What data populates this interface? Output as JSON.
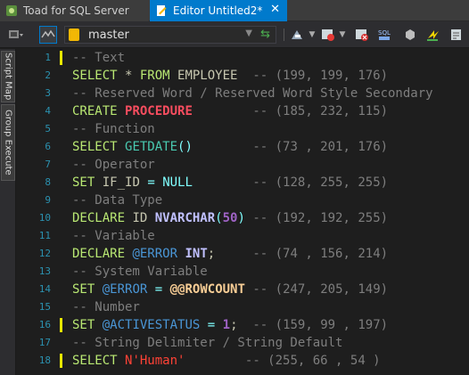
{
  "tabs": [
    {
      "label": "Toad for SQL Server",
      "active": false
    },
    {
      "label": "Editor Untitled2*",
      "active": true,
      "close": "✕"
    }
  ],
  "toolbar": {
    "database": "master"
  },
  "side_tabs": [
    "Script Map",
    "Group Execute"
  ],
  "colors": {
    "accent": "#007acc",
    "line_marker": "#e7e700",
    "keyword": "#b9e873",
    "comment": "#7e7e7e"
  },
  "editor": {
    "lines": [
      {
        "n": "1",
        "marked": true,
        "tokens": [
          {
            "c": "c-comment",
            "t": "-- Text"
          }
        ]
      },
      {
        "n": "2",
        "marked": false,
        "tokens": [
          {
            "c": "c-kw",
            "t": "SELECT"
          },
          {
            "c": "c-text",
            "t": " * "
          },
          {
            "c": "c-kw",
            "t": "FROM"
          },
          {
            "c": "c-text",
            "t": " EMPLOYEE  "
          },
          {
            "c": "c-comment",
            "t": "-- (199, 199, 176)"
          }
        ]
      },
      {
        "n": "3",
        "marked": false,
        "tokens": [
          {
            "c": "c-comment",
            "t": "-- Reserved Word / Reserved Word Style Secondary"
          }
        ]
      },
      {
        "n": "4",
        "marked": false,
        "tokens": [
          {
            "c": "c-kw",
            "t": "CREATE"
          },
          {
            "c": "c-text",
            "t": " "
          },
          {
            "c": "c-proc",
            "t": "PROCEDURE"
          },
          {
            "c": "c-text",
            "t": "        "
          },
          {
            "c": "c-comment",
            "t": "-- (185, 232, 115)"
          }
        ]
      },
      {
        "n": "5",
        "marked": false,
        "tokens": [
          {
            "c": "c-comment",
            "t": "-- Function"
          }
        ]
      },
      {
        "n": "6",
        "marked": false,
        "tokens": [
          {
            "c": "c-kw",
            "t": "SELECT"
          },
          {
            "c": "c-text",
            "t": " "
          },
          {
            "c": "c-func",
            "t": "GETDATE"
          },
          {
            "c": "c-op",
            "t": "()"
          },
          {
            "c": "c-text",
            "t": "        "
          },
          {
            "c": "c-comment",
            "t": "-- (73 , 201, 176)"
          }
        ]
      },
      {
        "n": "7",
        "marked": false,
        "tokens": [
          {
            "c": "c-comment",
            "t": "-- Operator"
          }
        ]
      },
      {
        "n": "8",
        "marked": false,
        "tokens": [
          {
            "c": "c-kw",
            "t": "SET"
          },
          {
            "c": "c-text",
            "t": " IF_ID "
          },
          {
            "c": "c-op",
            "t": "="
          },
          {
            "c": "c-text",
            "t": " "
          },
          {
            "c": "c-op",
            "t": "NULL"
          },
          {
            "c": "c-text",
            "t": "        "
          },
          {
            "c": "c-comment",
            "t": "-- (128, 255, 255)"
          }
        ]
      },
      {
        "n": "9",
        "marked": false,
        "tokens": [
          {
            "c": "c-comment",
            "t": "-- Data Type"
          }
        ]
      },
      {
        "n": "10",
        "marked": false,
        "tokens": [
          {
            "c": "c-kw",
            "t": "DECLARE"
          },
          {
            "c": "c-text",
            "t": " ID "
          },
          {
            "c": "c-type",
            "t": "NVARCHAR"
          },
          {
            "c": "c-op",
            "t": "("
          },
          {
            "c": "c-num",
            "t": "50"
          },
          {
            "c": "c-op",
            "t": ")"
          },
          {
            "c": "c-text",
            "t": " "
          },
          {
            "c": "c-comment",
            "t": "-- (192, 192, 255)"
          }
        ]
      },
      {
        "n": "11",
        "marked": false,
        "tokens": [
          {
            "c": "c-comment",
            "t": "-- Variable"
          }
        ]
      },
      {
        "n": "12",
        "marked": false,
        "tokens": [
          {
            "c": "c-kw",
            "t": "DECLARE"
          },
          {
            "c": "c-text",
            "t": " "
          },
          {
            "c": "c-var",
            "t": "@ERROR"
          },
          {
            "c": "c-text",
            "t": " "
          },
          {
            "c": "c-type",
            "t": "INT"
          },
          {
            "c": "c-text",
            "t": ";     "
          },
          {
            "c": "c-comment",
            "t": "-- (74 , 156, 214)"
          }
        ]
      },
      {
        "n": "13",
        "marked": false,
        "tokens": [
          {
            "c": "c-comment",
            "t": "-- System Variable"
          }
        ]
      },
      {
        "n": "14",
        "marked": false,
        "tokens": [
          {
            "c": "c-kw",
            "t": "SET"
          },
          {
            "c": "c-text",
            "t": " "
          },
          {
            "c": "c-var",
            "t": "@ERROR"
          },
          {
            "c": "c-text",
            "t": " "
          },
          {
            "c": "c-op",
            "t": "="
          },
          {
            "c": "c-text",
            "t": " "
          },
          {
            "c": "c-sysvar",
            "t": "@@ROWCOUNT"
          },
          {
            "c": "c-text",
            "t": " "
          },
          {
            "c": "c-comment",
            "t": "-- (247, 205, 149)"
          }
        ]
      },
      {
        "n": "15",
        "marked": false,
        "tokens": [
          {
            "c": "c-comment",
            "t": "-- Number"
          }
        ]
      },
      {
        "n": "16",
        "marked": true,
        "tokens": [
          {
            "c": "c-kw",
            "t": "SET"
          },
          {
            "c": "c-text",
            "t": " "
          },
          {
            "c": "c-var",
            "t": "@ACTIVESTATUS"
          },
          {
            "c": "c-text",
            "t": " "
          },
          {
            "c": "c-op",
            "t": "="
          },
          {
            "c": "c-text",
            "t": " "
          },
          {
            "c": "c-num",
            "t": "1"
          },
          {
            "c": "c-text",
            "t": ";  "
          },
          {
            "c": "c-comment",
            "t": "-- (159, 99 , 197)"
          }
        ]
      },
      {
        "n": "17",
        "marked": false,
        "tokens": [
          {
            "c": "c-comment",
            "t": "-- String Delimiter / String Default"
          }
        ]
      },
      {
        "n": "18",
        "marked": true,
        "tokens": [
          {
            "c": "c-kw",
            "t": "SELECT"
          },
          {
            "c": "c-text",
            "t": " "
          },
          {
            "c": "c-str",
            "t": "N'Human'"
          },
          {
            "c": "c-text",
            "t": "        "
          },
          {
            "c": "c-comment",
            "t": "-- (255, 66 , 54 )"
          }
        ]
      }
    ]
  }
}
